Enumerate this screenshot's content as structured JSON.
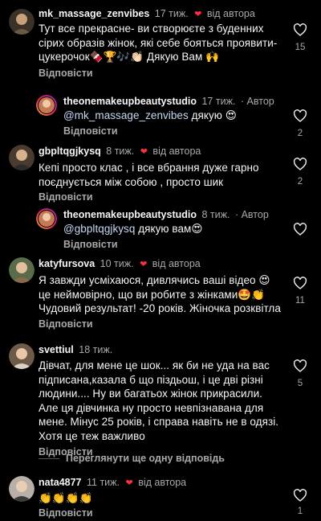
{
  "comments": [
    {
      "user": "mk_massage_zenvibes",
      "ago": "17 тиж.",
      "liked_label": "від автора",
      "text": "Тут все прекрасне- ви створюєте з буденних сірих образів жінок, які себе бояться проявити- цукерочок🍫🏆🎶👏🏻 Дякую Вам 🙌",
      "reply": "Відповісти",
      "likes": "15"
    },
    {
      "user": "theonemakeupbeautystudio",
      "ago": "17 тиж.",
      "tag": "Автор",
      "mention": "@mk_massage_zenvibes",
      "text": " дякую 😍",
      "reply": "Відповісти",
      "likes": "2"
    },
    {
      "user": "gbpltqgjkysq",
      "ago": "8 тиж.",
      "liked_label": "від автора",
      "text": "Кепі просто клас , і все вбрання дуже гарно поєднується між собою , просто шик",
      "reply": "Відповісти",
      "likes": "2"
    },
    {
      "user": "theonemakeupbeautystudio",
      "ago": "8 тиж.",
      "tag": "Автор",
      "mention": "@gbpltqgjkysq",
      "text": " дякую вам😍",
      "reply": "Відповісти",
      "likes": ""
    },
    {
      "user": "katyfursova",
      "ago": "10 тиж.",
      "liked_label": "від автора",
      "text": "Я завжди усміхаюся, дивлячись ваші відео 😍 це неймовірно, що ви робите з жінками🤩👏 Чудовий результат! -20 років. Жіночка розквітла",
      "reply": "Відповісти",
      "likes": "11"
    },
    {
      "user": "svettiul",
      "ago": "18 тиж.",
      "text": "Дівчат, для мене це шок... як би не уда на вас підписана,казала б що піздьош, і це дві різні людини.... Ну ви багатьох жінок прикрасили. Але ця дівчинка ну просто невпізнавана для мене. Мінус 25 років, і справа навіть не в одязі. Хотя це теж важливо",
      "reply": "Відповісти",
      "likes": "5"
    },
    {
      "user": "nata4877",
      "ago": "11 тиж.",
      "liked_label": "від автора",
      "text": "👏👏👏👏",
      "reply": "Відповісти",
      "likes": "1"
    }
  ],
  "more_replies": "Переглянути ще одну відповідь",
  "colors": {
    "heart": "#ff3040",
    "muted": "#a8a8a8",
    "background": "#000000"
  }
}
